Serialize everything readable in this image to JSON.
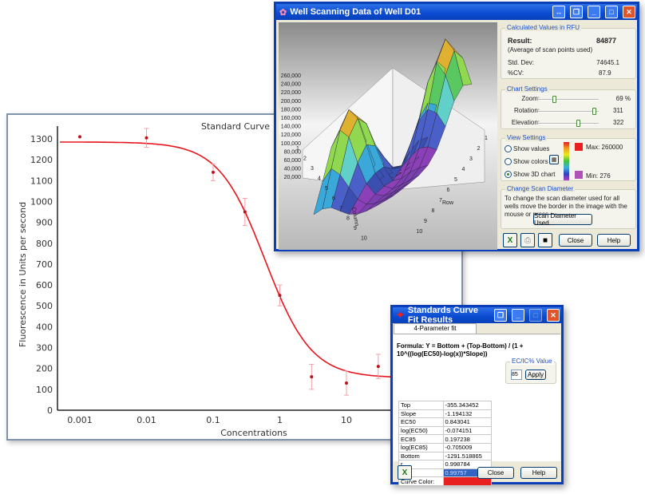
{
  "chart_data": {
    "type": "scatter",
    "title": "Standard Curve",
    "xlabel": "Concentrations",
    "ylabel": "Fluorescence in Units per second",
    "xscale": "log",
    "xlim": [
      0.0005,
      60
    ],
    "ylim": [
      0,
      1350
    ],
    "xticks": [
      "0.001",
      "0.01",
      "0.1",
      "1",
      "10"
    ],
    "xtick_values": [
      0.001,
      0.01,
      0.1,
      1,
      10
    ],
    "yticks": [
      0,
      100,
      200,
      300,
      400,
      500,
      600,
      700,
      800,
      900,
      1000,
      1100,
      1200,
      1300
    ],
    "grid": false,
    "points": [
      {
        "x": 0.001,
        "y": 1310,
        "err": 0
      },
      {
        "x": 0.01,
        "y": 1305,
        "err": 45
      },
      {
        "x": 0.1,
        "y": 1140,
        "err": 40
      },
      {
        "x": 0.3,
        "y": 950,
        "err": 65
      },
      {
        "x": 1,
        "y": 550,
        "err": 50
      },
      {
        "x": 3,
        "y": 160,
        "err": 60
      },
      {
        "x": 10,
        "y": 130,
        "err": 58
      },
      {
        "x": 30,
        "y": 210,
        "err": 58
      }
    ],
    "fit_curve": {
      "top": 1285,
      "bottom": 155,
      "ec50": 0.6,
      "hill": 1.25
    },
    "colors": {
      "curve": "#e8141c",
      "points": "#c0101a",
      "errorbars": "#f0a0a8"
    }
  },
  "well_window": {
    "title": "Well Scanning Data of Well D01",
    "plot3d": {
      "z_ticks": [
        "260,000",
        "240,000",
        "220,000",
        "200,000",
        "180,000",
        "160,000",
        "140,000",
        "120,000",
        "100,000",
        "80,000",
        "60,000",
        "40,000",
        "20,000"
      ],
      "column_label": "Column",
      "row_label": "Row",
      "column_ticks": [
        "1",
        "2",
        "3",
        "4",
        "5",
        "6",
        "7",
        "8",
        "9",
        "10"
      ],
      "row_ticks": [
        "1",
        "2",
        "3",
        "4",
        "5",
        "6",
        "7",
        "8",
        "9",
        "10"
      ]
    },
    "calc": {
      "legend": "Calculated Values in RFU",
      "result_label": "Result:",
      "result_value": "84877",
      "note": "(Average of scan points used)",
      "std_label": "Std. Dev:",
      "std_value": "74645.1",
      "cv_label": "%CV:",
      "cv_value": "87.9"
    },
    "chart_settings": {
      "legend": "Chart Settings",
      "zoom_label": "Zoom:",
      "zoom_value": "69 %",
      "zoom_level": 69,
      "rotation_label": "Rotation:",
      "rotation_value": "311",
      "elevation_label": "Elevation:",
      "elevation_value": "322"
    },
    "view_settings": {
      "legend": "View Settings",
      "options": [
        "Show values",
        "Show colors",
        "Show 3D chart"
      ],
      "selected": 2,
      "max_label": "Max: 260000",
      "min_label": "Min:  276",
      "max_color": "#e82020",
      "min_color": "#b050b8"
    },
    "scan": {
      "legend": "Change Scan Diameter",
      "text": "To change the scan diameter used for all wells move the border in the image with the mouse or press :",
      "button": "Scan Diameter Used..."
    },
    "close": "Close",
    "help": "Help"
  },
  "fit_window": {
    "title": "Standards Curve Fit Results",
    "tab": "4-Parameter fit",
    "formula": "Formula: Y = Bottom + (Top-Bottom) / (1 + 10^((log(EC50)-log(x))*Slope))",
    "ec_legend": "EC/IC% Value",
    "ec_value": "85",
    "apply": "Apply",
    "rows": [
      [
        "Top",
        "-355.343452"
      ],
      [
        "Slope",
        "-1.194132"
      ],
      [
        "EC50",
        "0.843041"
      ],
      [
        "log(EC50)",
        "-0.074151"
      ],
      [
        "EC85",
        "0.197238"
      ],
      [
        "log(EC85)",
        "-0.705009"
      ],
      [
        "Bottom",
        "-1291.518865"
      ],
      [
        "r",
        "0.998784"
      ],
      [
        "r²",
        "0.99757"
      ],
      [
        "Curve Color:",
        ""
      ]
    ],
    "curve_color": "#e82020",
    "close": "Close",
    "help": "Help"
  }
}
